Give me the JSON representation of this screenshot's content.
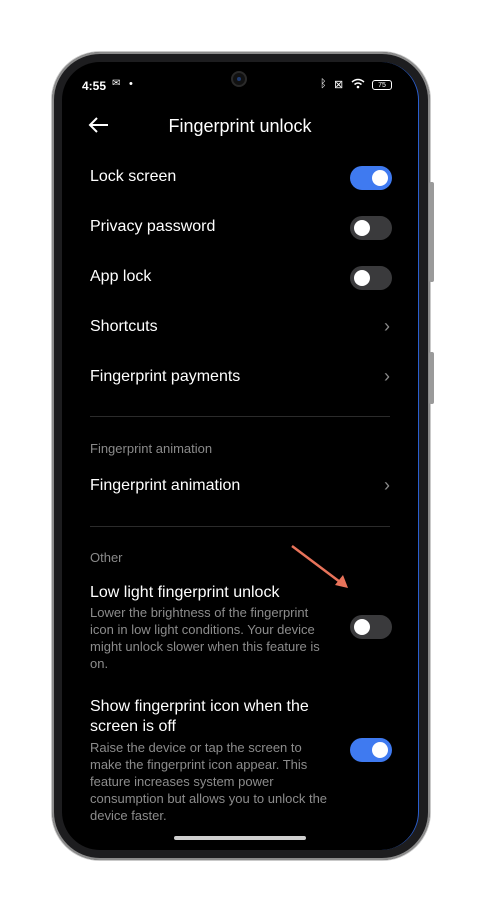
{
  "status": {
    "time": "4:55",
    "battery": "75"
  },
  "header": {
    "title": "Fingerprint unlock"
  },
  "items": {
    "lock_screen": {
      "label": "Lock screen",
      "on": true
    },
    "privacy_password": {
      "label": "Privacy password",
      "on": false
    },
    "app_lock": {
      "label": "App lock",
      "on": false
    },
    "shortcuts": {
      "label": "Shortcuts"
    },
    "fingerprint_payments": {
      "label": "Fingerprint payments"
    }
  },
  "section_animation": {
    "heading": "Fingerprint animation",
    "item": {
      "label": "Fingerprint animation"
    }
  },
  "section_other": {
    "heading": "Other",
    "low_light": {
      "label": "Low light fingerprint unlock",
      "description": "Lower the brightness of the fingerprint icon in low light conditions. Your device might unlock slower when this feature is on.",
      "on": false
    },
    "show_icon": {
      "label": "Show fingerprint icon when the screen is off",
      "description": "Raise the device or tap the screen to make the fingerprint icon appear. This feature increases system power consumption but allows you to unlock the device faster.",
      "on": true
    }
  },
  "colors": {
    "accent": "#3f7af0",
    "annotation_arrow": "#e8735a"
  },
  "icons": [
    "back-arrow-icon",
    "chevron-right-icon",
    "bluetooth-icon",
    "wifi-icon",
    "battery-icon",
    "camera-cutout"
  ]
}
